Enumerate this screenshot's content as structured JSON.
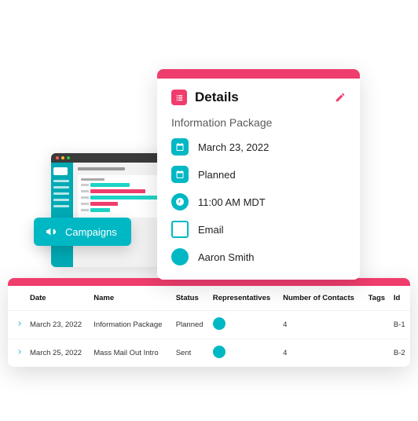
{
  "campaigns_pill": {
    "label": "Campaigns"
  },
  "details": {
    "title": "Details",
    "subtitle": "Information Package",
    "rows": {
      "date": "March 23, 2022",
      "status": "Planned",
      "time": "11:00 AM MDT",
      "method": "Email",
      "owner": "Aaron Smith"
    }
  },
  "table": {
    "headers": {
      "date": "Date",
      "name": "Name",
      "status": "Status",
      "reps": "Representatives",
      "contacts": "Number of Contacts",
      "tags": "Tags",
      "id": "Id"
    },
    "rows": [
      {
        "date": "March 23, 2022",
        "name": "Information Package",
        "status": "Planned",
        "contacts": "4",
        "tags": "",
        "id": "B-1"
      },
      {
        "date": "March 25, 2022",
        "name": "Mass Mail Out Intro",
        "status": "Sent",
        "contacts": "4",
        "tags": "",
        "id": "B-2"
      }
    ]
  }
}
